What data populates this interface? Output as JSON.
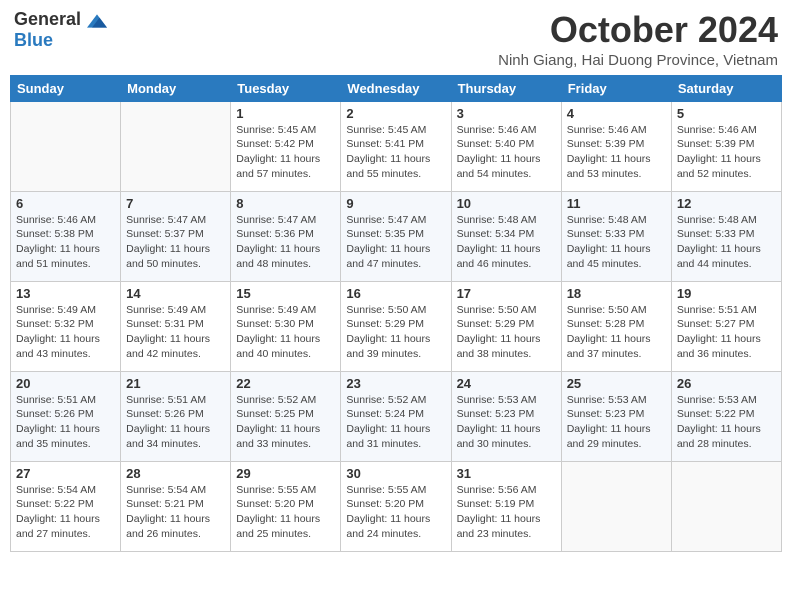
{
  "header": {
    "logo_general": "General",
    "logo_blue": "Blue",
    "month_title": "October 2024",
    "location": "Ninh Giang, Hai Duong Province, Vietnam"
  },
  "weekdays": [
    "Sunday",
    "Monday",
    "Tuesday",
    "Wednesday",
    "Thursday",
    "Friday",
    "Saturday"
  ],
  "weeks": [
    [
      {
        "day": "",
        "sunrise": "",
        "sunset": "",
        "daylight": ""
      },
      {
        "day": "",
        "sunrise": "",
        "sunset": "",
        "daylight": ""
      },
      {
        "day": "1",
        "sunrise": "Sunrise: 5:45 AM",
        "sunset": "Sunset: 5:42 PM",
        "daylight": "Daylight: 11 hours and 57 minutes."
      },
      {
        "day": "2",
        "sunrise": "Sunrise: 5:45 AM",
        "sunset": "Sunset: 5:41 PM",
        "daylight": "Daylight: 11 hours and 55 minutes."
      },
      {
        "day": "3",
        "sunrise": "Sunrise: 5:46 AM",
        "sunset": "Sunset: 5:40 PM",
        "daylight": "Daylight: 11 hours and 54 minutes."
      },
      {
        "day": "4",
        "sunrise": "Sunrise: 5:46 AM",
        "sunset": "Sunset: 5:39 PM",
        "daylight": "Daylight: 11 hours and 53 minutes."
      },
      {
        "day": "5",
        "sunrise": "Sunrise: 5:46 AM",
        "sunset": "Sunset: 5:39 PM",
        "daylight": "Daylight: 11 hours and 52 minutes."
      }
    ],
    [
      {
        "day": "6",
        "sunrise": "Sunrise: 5:46 AM",
        "sunset": "Sunset: 5:38 PM",
        "daylight": "Daylight: 11 hours and 51 minutes."
      },
      {
        "day": "7",
        "sunrise": "Sunrise: 5:47 AM",
        "sunset": "Sunset: 5:37 PM",
        "daylight": "Daylight: 11 hours and 50 minutes."
      },
      {
        "day": "8",
        "sunrise": "Sunrise: 5:47 AM",
        "sunset": "Sunset: 5:36 PM",
        "daylight": "Daylight: 11 hours and 48 minutes."
      },
      {
        "day": "9",
        "sunrise": "Sunrise: 5:47 AM",
        "sunset": "Sunset: 5:35 PM",
        "daylight": "Daylight: 11 hours and 47 minutes."
      },
      {
        "day": "10",
        "sunrise": "Sunrise: 5:48 AM",
        "sunset": "Sunset: 5:34 PM",
        "daylight": "Daylight: 11 hours and 46 minutes."
      },
      {
        "day": "11",
        "sunrise": "Sunrise: 5:48 AM",
        "sunset": "Sunset: 5:33 PM",
        "daylight": "Daylight: 11 hours and 45 minutes."
      },
      {
        "day": "12",
        "sunrise": "Sunrise: 5:48 AM",
        "sunset": "Sunset: 5:33 PM",
        "daylight": "Daylight: 11 hours and 44 minutes."
      }
    ],
    [
      {
        "day": "13",
        "sunrise": "Sunrise: 5:49 AM",
        "sunset": "Sunset: 5:32 PM",
        "daylight": "Daylight: 11 hours and 43 minutes."
      },
      {
        "day": "14",
        "sunrise": "Sunrise: 5:49 AM",
        "sunset": "Sunset: 5:31 PM",
        "daylight": "Daylight: 11 hours and 42 minutes."
      },
      {
        "day": "15",
        "sunrise": "Sunrise: 5:49 AM",
        "sunset": "Sunset: 5:30 PM",
        "daylight": "Daylight: 11 hours and 40 minutes."
      },
      {
        "day": "16",
        "sunrise": "Sunrise: 5:50 AM",
        "sunset": "Sunset: 5:29 PM",
        "daylight": "Daylight: 11 hours and 39 minutes."
      },
      {
        "day": "17",
        "sunrise": "Sunrise: 5:50 AM",
        "sunset": "Sunset: 5:29 PM",
        "daylight": "Daylight: 11 hours and 38 minutes."
      },
      {
        "day": "18",
        "sunrise": "Sunrise: 5:50 AM",
        "sunset": "Sunset: 5:28 PM",
        "daylight": "Daylight: 11 hours and 37 minutes."
      },
      {
        "day": "19",
        "sunrise": "Sunrise: 5:51 AM",
        "sunset": "Sunset: 5:27 PM",
        "daylight": "Daylight: 11 hours and 36 minutes."
      }
    ],
    [
      {
        "day": "20",
        "sunrise": "Sunrise: 5:51 AM",
        "sunset": "Sunset: 5:26 PM",
        "daylight": "Daylight: 11 hours and 35 minutes."
      },
      {
        "day": "21",
        "sunrise": "Sunrise: 5:51 AM",
        "sunset": "Sunset: 5:26 PM",
        "daylight": "Daylight: 11 hours and 34 minutes."
      },
      {
        "day": "22",
        "sunrise": "Sunrise: 5:52 AM",
        "sunset": "Sunset: 5:25 PM",
        "daylight": "Daylight: 11 hours and 33 minutes."
      },
      {
        "day": "23",
        "sunrise": "Sunrise: 5:52 AM",
        "sunset": "Sunset: 5:24 PM",
        "daylight": "Daylight: 11 hours and 31 minutes."
      },
      {
        "day": "24",
        "sunrise": "Sunrise: 5:53 AM",
        "sunset": "Sunset: 5:23 PM",
        "daylight": "Daylight: 11 hours and 30 minutes."
      },
      {
        "day": "25",
        "sunrise": "Sunrise: 5:53 AM",
        "sunset": "Sunset: 5:23 PM",
        "daylight": "Daylight: 11 hours and 29 minutes."
      },
      {
        "day": "26",
        "sunrise": "Sunrise: 5:53 AM",
        "sunset": "Sunset: 5:22 PM",
        "daylight": "Daylight: 11 hours and 28 minutes."
      }
    ],
    [
      {
        "day": "27",
        "sunrise": "Sunrise: 5:54 AM",
        "sunset": "Sunset: 5:22 PM",
        "daylight": "Daylight: 11 hours and 27 minutes."
      },
      {
        "day": "28",
        "sunrise": "Sunrise: 5:54 AM",
        "sunset": "Sunset: 5:21 PM",
        "daylight": "Daylight: 11 hours and 26 minutes."
      },
      {
        "day": "29",
        "sunrise": "Sunrise: 5:55 AM",
        "sunset": "Sunset: 5:20 PM",
        "daylight": "Daylight: 11 hours and 25 minutes."
      },
      {
        "day": "30",
        "sunrise": "Sunrise: 5:55 AM",
        "sunset": "Sunset: 5:20 PM",
        "daylight": "Daylight: 11 hours and 24 minutes."
      },
      {
        "day": "31",
        "sunrise": "Sunrise: 5:56 AM",
        "sunset": "Sunset: 5:19 PM",
        "daylight": "Daylight: 11 hours and 23 minutes."
      },
      {
        "day": "",
        "sunrise": "",
        "sunset": "",
        "daylight": ""
      },
      {
        "day": "",
        "sunrise": "",
        "sunset": "",
        "daylight": ""
      }
    ]
  ]
}
